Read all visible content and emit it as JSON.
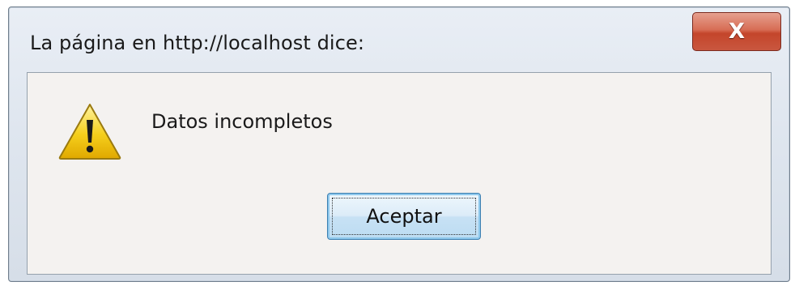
{
  "dialog": {
    "title": "La página en http://localhost dice:",
    "close_label": "X",
    "message": "Datos incompletos",
    "icon": "warning-icon",
    "ok_label": "Aceptar"
  },
  "colors": {
    "close_button": "#c9573f",
    "client_bg": "#f4f2f0",
    "warning_fill": "#f2c200",
    "ok_button_border": "#3c7fb1"
  }
}
